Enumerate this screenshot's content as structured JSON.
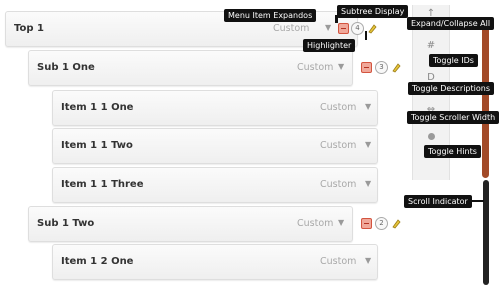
{
  "items": [
    {
      "title": "Top 1",
      "type": "Custom"
    },
    {
      "title": "Sub 1 One",
      "type": "Custom"
    },
    {
      "title": "Item 1 1 One",
      "type": "Custom"
    },
    {
      "title": "Item 1 1 Two",
      "type": "Custom"
    },
    {
      "title": "Item 1 1 Three",
      "type": "Custom"
    },
    {
      "title": "Sub 1 Two",
      "type": "Custom"
    },
    {
      "title": "Item 1 2 One",
      "type": "Custom"
    }
  ],
  "counts": {
    "top1": "4",
    "sub1one": "3",
    "sub1two": "2"
  },
  "callouts": {
    "menu_item_expandos": "Menu Item Expandos",
    "subtree_display": "Subtree Display",
    "highlighter": "Highlighter",
    "expand_collapse_all": "Expand/Collapse All",
    "toggle_ids": "Toggle IDs",
    "toggle_descriptions": "Toggle Descriptions",
    "toggle_scroller_width": "Toggle Scroller Width",
    "toggle_hints": "Toggle Hints",
    "scroll_indicator": "Scroll Indicator"
  },
  "rail_glyphs": {
    "expand": "↑",
    "ids": "#",
    "descriptions": "D",
    "scroller_width": "⇔"
  },
  "colors": {
    "expando": "#f0a89a",
    "scroll_active": "#a24a28",
    "scroll_track": "#222222"
  }
}
